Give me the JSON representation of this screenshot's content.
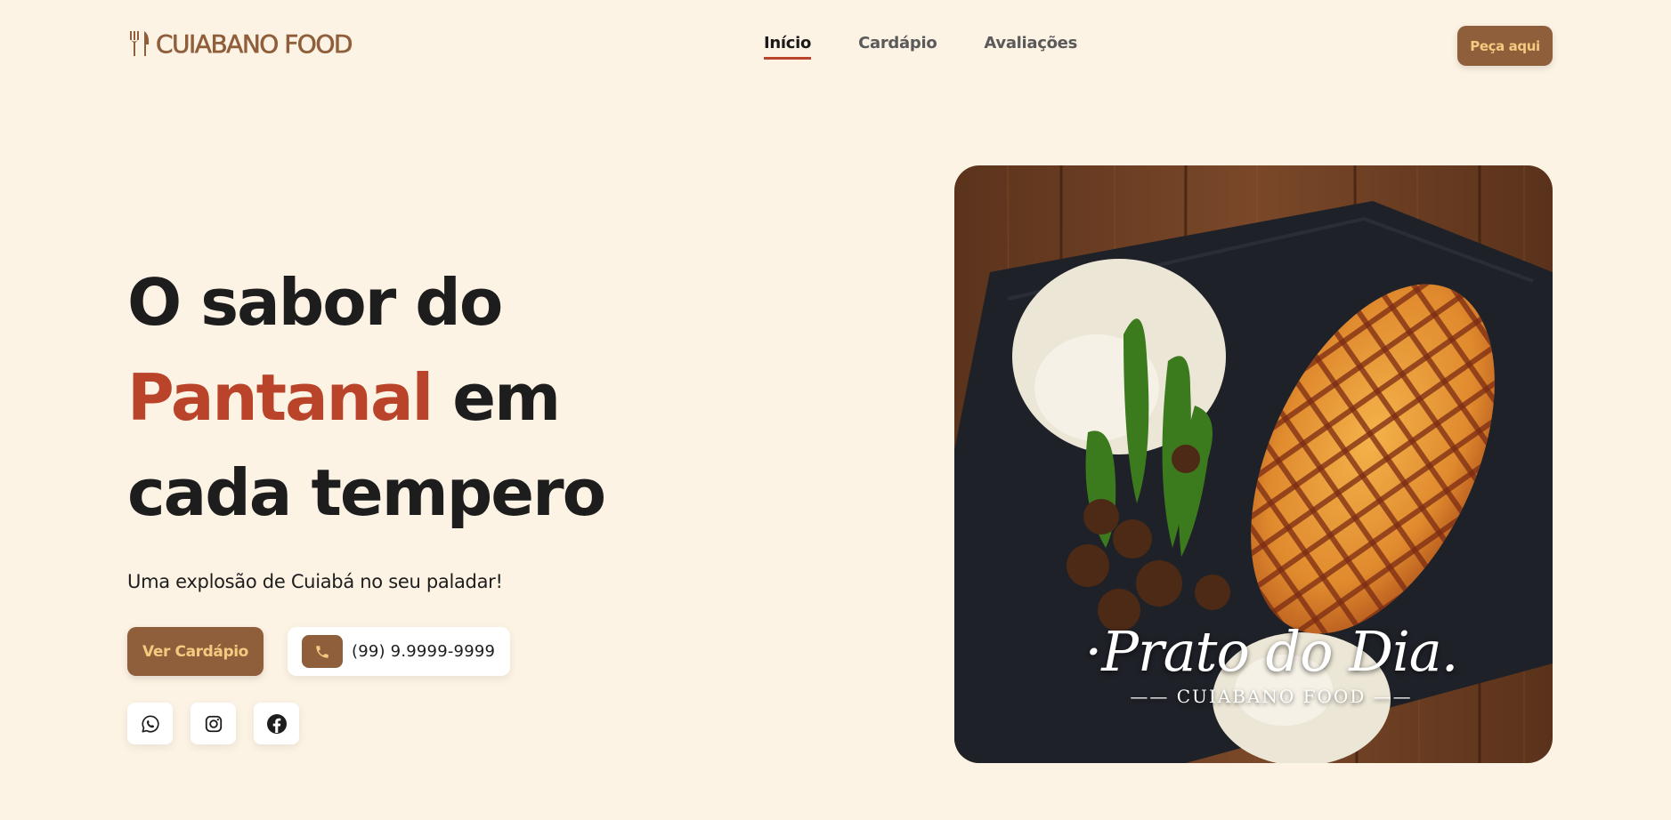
{
  "header": {
    "logo_text": "CUIABANO FOOD",
    "nav": [
      {
        "label": "Início",
        "active": true
      },
      {
        "label": "Cardápio",
        "active": false
      },
      {
        "label": "Avaliações",
        "active": false
      }
    ],
    "order_button": "Peça aqui"
  },
  "hero": {
    "title_line1": "O sabor do",
    "title_accent": "Pantanal",
    "title_after_accent": " em",
    "title_line3": "cada tempero",
    "subtitle": "Uma explosão de Cuiabá no seu paladar!",
    "menu_button": "Ver Cardápio",
    "phone": "(99) 9.9999-9999",
    "social": [
      "whatsapp-icon",
      "instagram-icon",
      "facebook-icon"
    ]
  },
  "image": {
    "caption_title": "·Prato do Dia.",
    "caption_brand": "CUIABANO FOOD"
  },
  "colors": {
    "background": "#fdf3e4",
    "brand": "#8f5e3b",
    "accent": "#b9442a",
    "button_text": "#f4c980"
  }
}
